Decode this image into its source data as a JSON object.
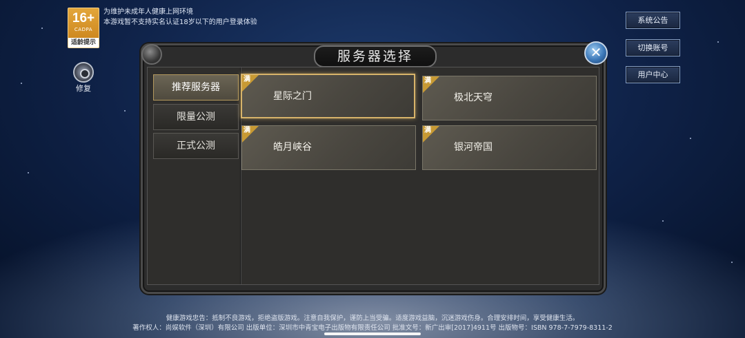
{
  "age_badge": {
    "rating": "16+",
    "org": "CADPA",
    "tip": "适龄提示"
  },
  "notice_lines": [
    "为维护未成年人健康上网环境",
    "本游戏暂不支持实名认证18岁以下的用户登录体验"
  ],
  "repair": {
    "label": "修复",
    "icon": "gear-icon"
  },
  "side_buttons": [
    "系统公告",
    "切换账号",
    "用户中心"
  ],
  "panel": {
    "title": "服务器选择",
    "close_glyph": "✕"
  },
  "tabs": [
    {
      "label": "推荐服务器",
      "active": true
    },
    {
      "label": "限量公测",
      "active": false
    },
    {
      "label": "正式公测",
      "active": false
    }
  ],
  "servers": [
    {
      "name": "星际之门",
      "status": "满",
      "selected": true
    },
    {
      "name": "极北天穹",
      "status": "满",
      "selected": false
    },
    {
      "name": "皓月峡谷",
      "status": "满",
      "selected": false
    },
    {
      "name": "银河帝国",
      "status": "满",
      "selected": false
    }
  ],
  "footer_lines": [
    "健康游戏忠告：抵制不良游戏，拒绝盗版游戏。注意自我保护，谨防上当受骗。适度游戏益脑，沉迷游戏伤身。合理安排时间，享受健康生活。",
    "著作权人：尚娱软件（深圳）有限公司 出版单位：深圳市中青宝电子出版物有限责任公司 批准文号：新广出审[2017]4911号 出版物号：ISBN 978-7-7979-8311-2"
  ],
  "colors": {
    "accent_gold": "#c89a34",
    "panel_bg": "#2c2c2c",
    "selected_border": "#d8b46a"
  }
}
